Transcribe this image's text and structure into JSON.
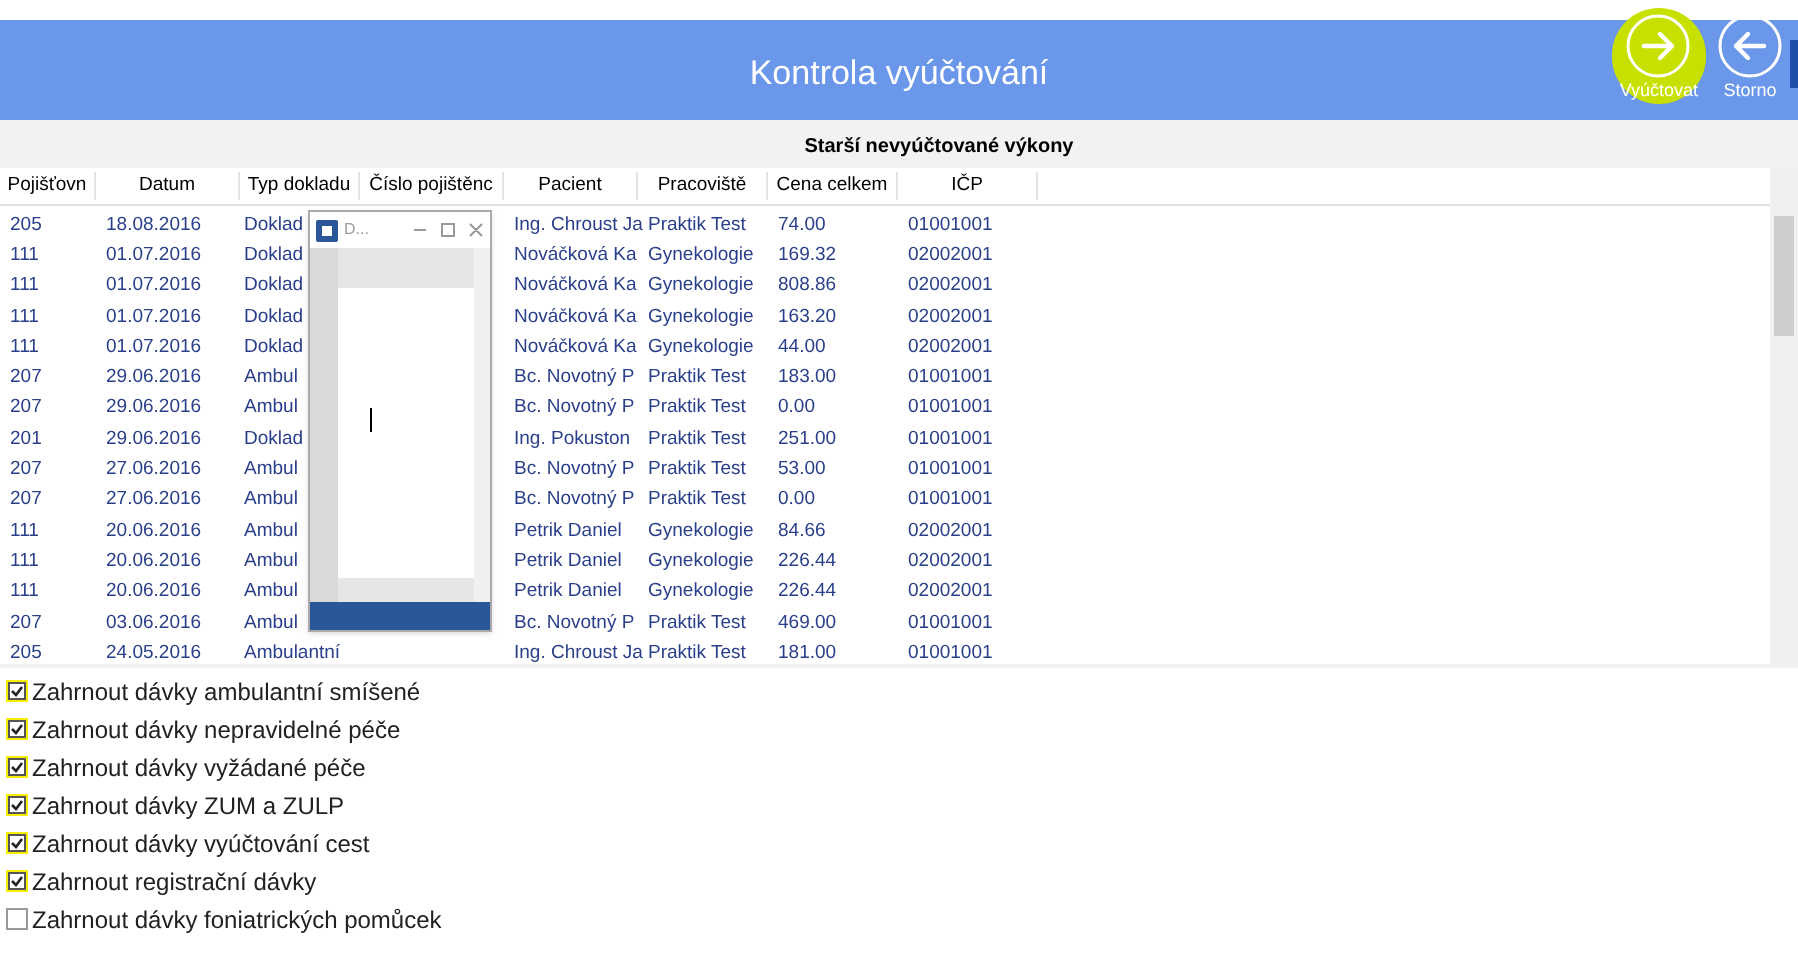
{
  "header": {
    "title": "Kontrola vyúčtování",
    "actions": [
      {
        "kind": "forward",
        "label": "Vyúčtovat",
        "highlighted": true
      },
      {
        "kind": "back",
        "label": "Storno",
        "highlighted": false
      }
    ]
  },
  "table": {
    "title": "Starší nevyúčtované výkony",
    "columns": [
      "Pojišťovn",
      "Datum",
      "Typ dokladu",
      "Číslo pojištěnc",
      "Pacient",
      "Pracoviště",
      "Cena celkem",
      "IČP"
    ],
    "rows": [
      [
        "205",
        "18.08.2016",
        "Doklad",
        "",
        "Ing. Chroust Ja",
        "Praktik Test",
        "74.00",
        "01001001"
      ],
      [
        "111",
        "01.07.2016",
        "Doklad",
        "",
        "Nováčková Ka",
        "Gynekologie",
        "169.32",
        "02002001"
      ],
      [
        "111",
        "01.07.2016",
        "Doklad",
        "",
        "Nováčková Ka",
        "Gynekologie",
        "808.86",
        "02002001"
      ],
      [
        "111",
        "01.07.2016",
        "Doklad",
        "",
        "Nováčková Ka",
        "Gynekologie",
        "163.20",
        "02002001"
      ],
      [
        "111",
        "01.07.2016",
        "Doklad",
        "",
        "Nováčková Ka",
        "Gynekologie",
        "44.00",
        "02002001"
      ],
      [
        "207",
        "29.06.2016",
        "Ambul",
        "",
        "Bc. Novotný P",
        "Praktik Test",
        "183.00",
        "01001001"
      ],
      [
        "207",
        "29.06.2016",
        "Ambul",
        "",
        "Bc. Novotný P",
        "Praktik Test",
        "0.00",
        "01001001"
      ],
      [
        "201",
        "29.06.2016",
        "Doklad",
        "",
        "Ing. Pokuston",
        "Praktik Test",
        "251.00",
        "01001001"
      ],
      [
        "207",
        "27.06.2016",
        "Ambul",
        "",
        "Bc. Novotný P",
        "Praktik Test",
        "53.00",
        "01001001"
      ],
      [
        "207",
        "27.06.2016",
        "Ambul",
        "",
        "Bc. Novotný P",
        "Praktik Test",
        "0.00",
        "01001001"
      ],
      [
        "111",
        "20.06.2016",
        "Ambul",
        "",
        "Petrik Daniel",
        "Gynekologie",
        "84.66",
        "02002001"
      ],
      [
        "111",
        "20.06.2016",
        "Ambul",
        "",
        "Petrik Daniel",
        "Gynekologie",
        "226.44",
        "02002001"
      ],
      [
        "111",
        "20.06.2016",
        "Ambul",
        "",
        "Petrik Daniel",
        "Gynekologie",
        "226.44",
        "02002001"
      ],
      [
        "207",
        "03.06.2016",
        "Ambul",
        "",
        "Bc. Novotný P",
        "Praktik Test",
        "469.00",
        "01001001"
      ],
      [
        "205",
        "24.05.2016",
        "Ambulantní",
        "",
        "Ing. Chroust Ja",
        "Praktik Test",
        "181.00",
        "01001001"
      ]
    ]
  },
  "word_window": {
    "title": "D..."
  },
  "options": [
    {
      "label": "Zahrnout dávky ambulantní smíšené",
      "checked": true
    },
    {
      "label": "Zahrnout dávky nepravidelné péče",
      "checked": true
    },
    {
      "label": "Zahrnout dávky vyžádané péče",
      "checked": true
    },
    {
      "label": "Zahrnout dávky ZUM a ZULP",
      "checked": true
    },
    {
      "label": "Zahrnout dávky vyúčtování cest",
      "checked": true
    },
    {
      "label": "Zahrnout registrační dávky",
      "checked": true
    },
    {
      "label": "Zahrnout dávky foniatrických pomůcek",
      "checked": false
    }
  ]
}
